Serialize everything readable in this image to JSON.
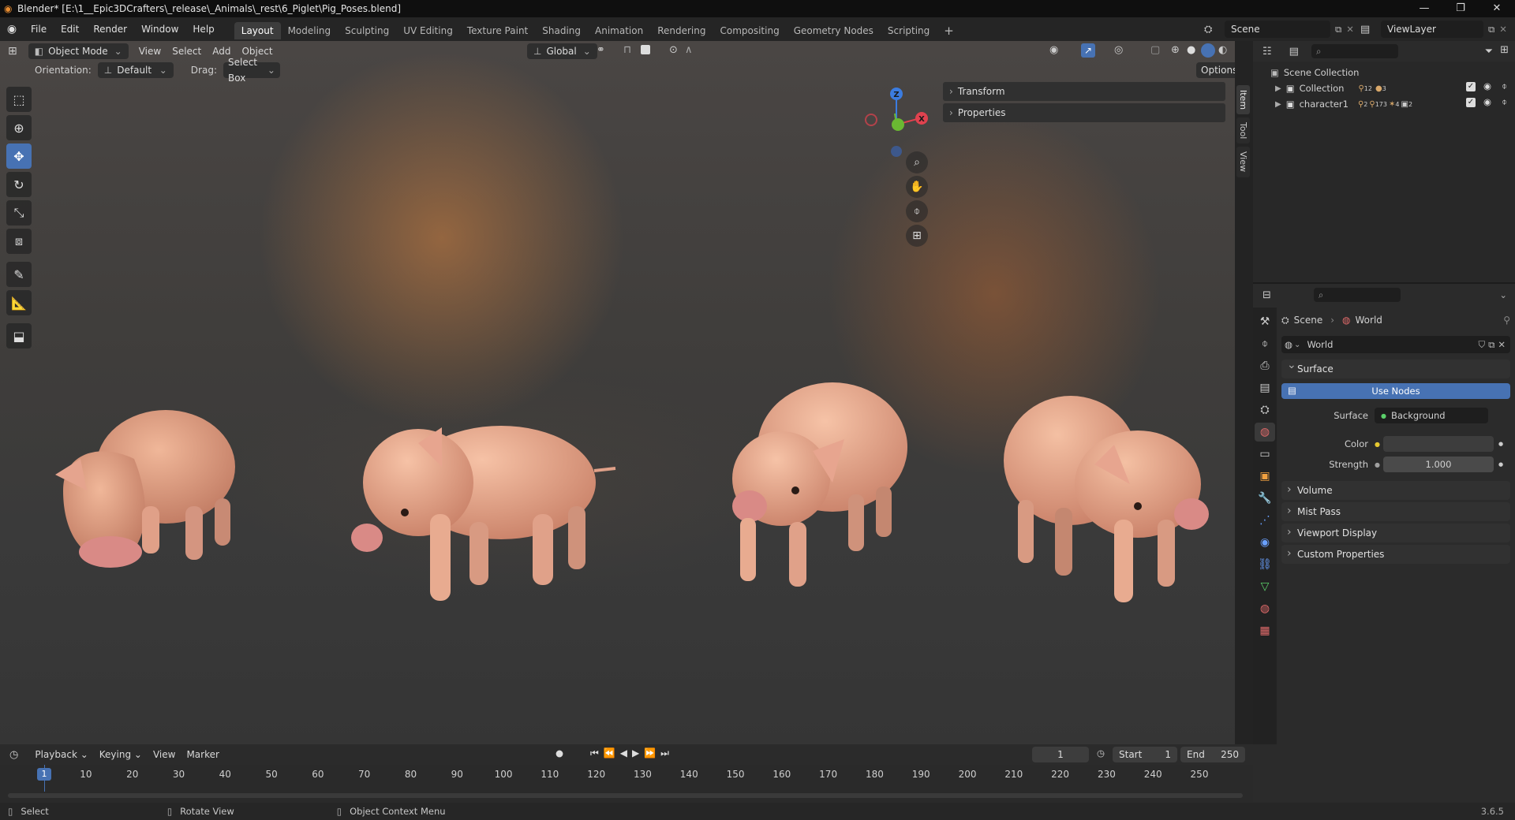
{
  "window": {
    "title": "Blender* [E:\\1__Epic3DCrafters\\_release\\_Animals\\_rest\\6_Piglet\\Pig_Poses.blend]",
    "controls": [
      "—",
      "❐",
      "✕"
    ]
  },
  "menu": [
    "File",
    "Edit",
    "Render",
    "Window",
    "Help"
  ],
  "workspaces": [
    {
      "label": "Layout",
      "active": true
    },
    {
      "label": "Modeling"
    },
    {
      "label": "Sculpting"
    },
    {
      "label": "UV Editing"
    },
    {
      "label": "Texture Paint"
    },
    {
      "label": "Shading"
    },
    {
      "label": "Animation"
    },
    {
      "label": "Rendering"
    },
    {
      "label": "Compositing"
    },
    {
      "label": "Geometry Nodes"
    },
    {
      "label": "Scripting"
    }
  ],
  "add_workspace": "+",
  "scene_field": "Scene",
  "viewlayer_field": "ViewLayer",
  "viewport_header": {
    "mode": "Object Mode",
    "menus": [
      "View",
      "Select",
      "Add",
      "Object"
    ],
    "transform_orientation": "Global",
    "options": "Options"
  },
  "tool_header": {
    "orientation_label": "Orientation:",
    "orientation_value": "Default",
    "drag_label": "Drag:",
    "drag_value": "Select Box"
  },
  "tools": [
    {
      "name": "select-box-tool",
      "glyph": "⬚",
      "active": false
    },
    {
      "name": "cursor-tool",
      "glyph": "⊕",
      "active": false
    },
    {
      "name": "move-tool",
      "glyph": "✥",
      "active": true
    },
    {
      "name": "rotate-tool",
      "glyph": "↻",
      "active": false
    },
    {
      "name": "scale-tool",
      "glyph": "⤡",
      "active": false
    },
    {
      "name": "transform-tool",
      "glyph": "⧈",
      "active": false
    },
    {
      "name": "annotate-tool",
      "glyph": "✎",
      "active": false
    },
    {
      "name": "measure-tool",
      "glyph": "📐",
      "active": false
    },
    {
      "name": "add-cube-tool",
      "glyph": "⬓",
      "active": false
    }
  ],
  "gizmo": {
    "z": "Z",
    "x": "X",
    "y": "Y"
  },
  "npanel": {
    "panels": [
      "Transform",
      "Properties"
    ],
    "tabs": [
      "Item",
      "Tool",
      "View"
    ]
  },
  "outliner": {
    "root": "Scene Collection",
    "items": [
      {
        "label": "Collection",
        "badge1": "12",
        "badge2": "3"
      },
      {
        "label": "character1",
        "badge1": "2",
        "badge2": "173",
        "badge3": "4",
        "badge4": "2"
      }
    ]
  },
  "properties": {
    "breadcrumb_scene": "Scene",
    "breadcrumb_world": "World",
    "world_field": "World",
    "surface_panel": "Surface",
    "use_nodes": "Use Nodes",
    "surface_label": "Surface",
    "surface_value": "Background",
    "color_label": "Color",
    "strength_label": "Strength",
    "strength_value": "1.000",
    "collapsed_panels": [
      "Volume",
      "Mist Pass",
      "Viewport Display",
      "Custom Properties"
    ]
  },
  "timeline": {
    "menus": [
      "Playback",
      "Keying",
      "View",
      "Marker"
    ],
    "current_frame": "1",
    "start_label": "Start",
    "start_value": "1",
    "end_label": "End",
    "end_value": "250",
    "playhead": "1",
    "ticks": [
      10,
      20,
      30,
      40,
      50,
      60,
      70,
      80,
      90,
      100,
      110,
      120,
      130,
      140,
      150,
      160,
      170,
      180,
      190,
      200,
      210,
      220,
      230,
      240,
      250
    ]
  },
  "statusbar": {
    "select": "Select",
    "rotate": "Rotate View",
    "context": "Object Context Menu",
    "version": "3.6.5"
  },
  "colors": {
    "accent": "#4772b3",
    "pig_skin": "#e6a58a",
    "pig_snout": "#d97f82"
  }
}
